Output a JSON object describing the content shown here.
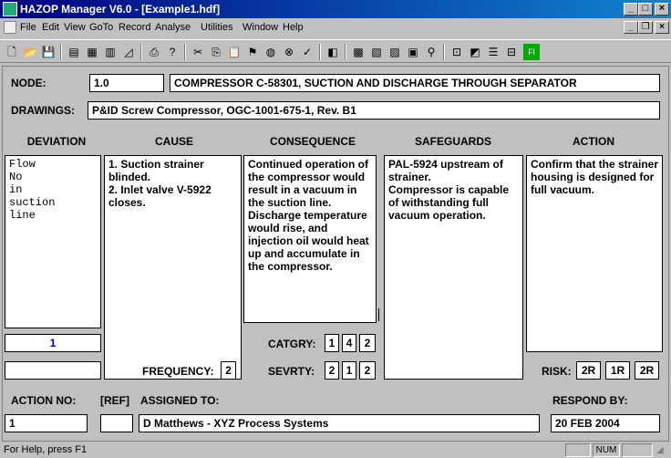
{
  "window": {
    "title": "HAZOP Manager V6.0 - [Example1.hdf]"
  },
  "menu": [
    "File",
    "Edit",
    "View",
    "GoTo",
    "Record",
    "Analyse",
    "Utilities",
    "Window",
    "Help"
  ],
  "node": {
    "label": "NODE:",
    "number": "1.0",
    "description": "COMPRESSOR C-58301, SUCTION AND DISCHARGE THROUGH SEPARATOR"
  },
  "drawings": {
    "label": "DRAWINGS:",
    "value": "P&ID Screw Compressor, OGC-1001-675-1, Rev. B1"
  },
  "columns": {
    "deviation": "DEVIATION",
    "cause": "CAUSE",
    "consequence": "CONSEQUENCE",
    "safeguards": "SAFEGUARDS",
    "action": "ACTION"
  },
  "deviation_text": "Flow\nNo\nin\nsuction\nline",
  "cause_text": "1. Suction strainer blinded.\n2. Inlet valve V-5922 closes.",
  "consequence_text": "Continued operation of the compressor would result in a vacuum in the suction line.\nDischarge temperature would rise, and injection oil would heat up and accumulate in the compressor.",
  "safeguards_text": "PAL-5924 upstream of strainer.\nCompressor is capable of withstanding full vacuum operation.",
  "action_text": "Confirm that the strainer housing is designed for full vacuum.",
  "record_number": "1",
  "frequency": {
    "label": "FREQUENCY:",
    "value": "2"
  },
  "catgry": {
    "label": "CATGRY:",
    "values": [
      "1",
      "4",
      "2"
    ]
  },
  "sevrty": {
    "label": "SEVRTY:",
    "values": [
      "2",
      "1",
      "2"
    ]
  },
  "risk": {
    "label": "RISK:",
    "values": [
      "2R",
      "1R",
      "2R"
    ]
  },
  "footer": {
    "action_no_label": "ACTION NO:",
    "ref_label": "[REF]",
    "assigned_to_label": "ASSIGNED TO:",
    "respond_by_label": "RESPOND BY:",
    "action_no": "1",
    "ref": "",
    "assigned_to": "D Matthews - XYZ Process Systems",
    "respond_by": "20 FEB 2004"
  },
  "status": {
    "help": "For Help, press F1",
    "num": "NUM"
  },
  "colors": {
    "title_start": "#000080",
    "title_end": "#1084d0",
    "record_number": "#0000cc"
  }
}
